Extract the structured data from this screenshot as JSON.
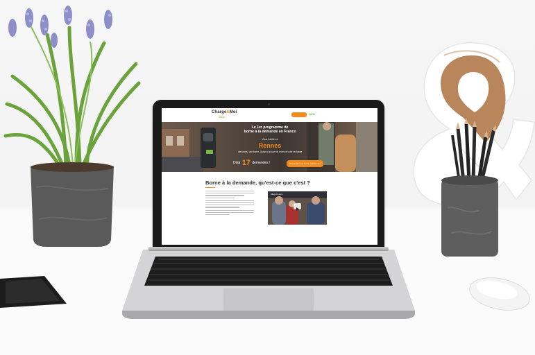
{
  "website": {
    "logo": {
      "part1": "Charge",
      "amp": "&",
      "part2": "Moi",
      "sub": "allego"
    },
    "nav_mark": "GEO",
    "hero": {
      "title_line1": "Le 1er programme de",
      "title_line2": "borne à la demande en France",
      "kicker": "Vous habitez à",
      "city": "Rennes",
      "description": "demandez une borne, Allego s'occupe de recevoir votre recharge",
      "count_prefix": "Déjà",
      "count": "17",
      "count_suffix": "demandes !",
      "cta": "Demandez une borne maintenant"
    },
    "section": {
      "title": "Borne à la demande, qu'est-ce que c'est ?",
      "video_caption": "Allego France"
    }
  },
  "scene": {
    "accent_color": "#f18a1c",
    "objects": [
      "potted-hyacinth-plant",
      "laptop",
      "wooden-ampersand-sculpture",
      "pencil-cup",
      "wireless-mouse",
      "smartphone"
    ]
  }
}
